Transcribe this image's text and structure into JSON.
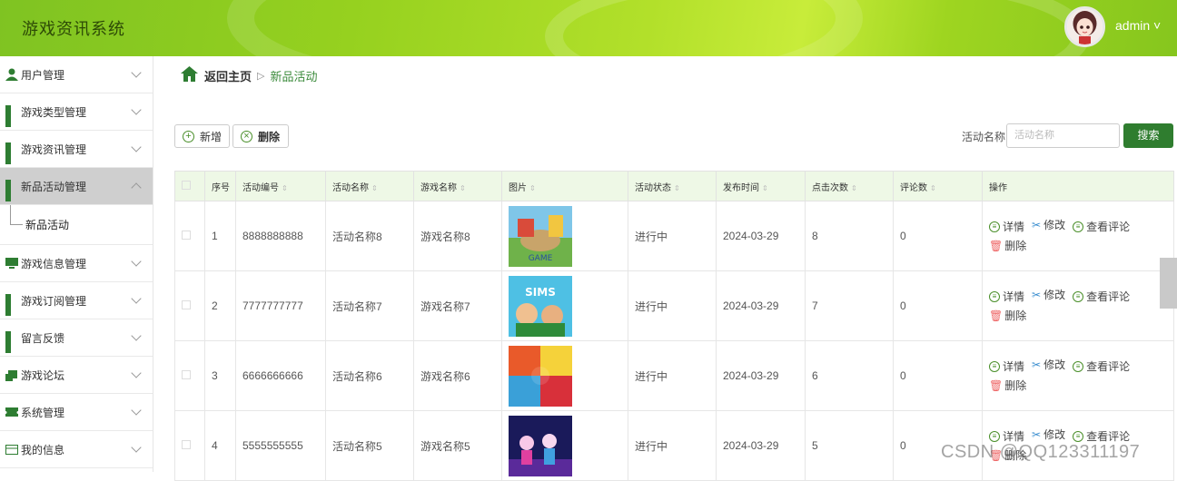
{
  "header": {
    "app_title": "游戏资讯系统",
    "user": "admin ˅"
  },
  "sidebar": {
    "items": [
      {
        "label": "用户管理",
        "icon": "user-icon",
        "active": false,
        "expanded": false
      },
      {
        "label": "游戏类型管理",
        "icon": "grid-icon",
        "active": false,
        "expanded": false
      },
      {
        "label": "游戏资讯管理",
        "icon": "grid-icon",
        "active": false,
        "expanded": false
      },
      {
        "label": "新品活动管理",
        "icon": "grid-icon",
        "active": true,
        "expanded": true
      },
      {
        "label": "游戏信息管理",
        "icon": "monitor-icon",
        "active": false,
        "expanded": false
      },
      {
        "label": "游戏订阅管理",
        "icon": "grid-icon",
        "active": false,
        "expanded": false
      },
      {
        "label": "留言反馈",
        "icon": "grid-icon",
        "active": false,
        "expanded": false
      },
      {
        "label": "游戏论坛",
        "icon": "forum-icon",
        "active": false,
        "expanded": false
      },
      {
        "label": "系统管理",
        "icon": "ticket-icon",
        "active": false,
        "expanded": false
      },
      {
        "label": "我的信息",
        "icon": "card-icon",
        "active": false,
        "expanded": false
      }
    ],
    "sub_item": "新品活动"
  },
  "breadcrumb": {
    "home": "返回主页",
    "separator": "▷",
    "current": "新品活动"
  },
  "toolbar": {
    "add_label": "新增",
    "delete_label": "删除"
  },
  "search": {
    "label": "活动名称",
    "placeholder": "活动名称",
    "button": "搜索"
  },
  "table": {
    "headers": [
      "序号",
      "活动编号",
      "活动名称",
      "游戏名称",
      "图片",
      "活动状态",
      "发布时间",
      "点击次数",
      "评论数",
      "操作"
    ],
    "rows": [
      {
        "index": "1",
        "code": "8888888888",
        "name": "活动名称8",
        "game": "游戏名称8",
        "status": "进行中",
        "date": "2024-03-29",
        "clicks": "8",
        "comments": "0"
      },
      {
        "index": "2",
        "code": "7777777777",
        "name": "活动名称7",
        "game": "游戏名称7",
        "status": "进行中",
        "date": "2024-03-29",
        "clicks": "7",
        "comments": "0"
      },
      {
        "index": "3",
        "code": "6666666666",
        "name": "活动名称6",
        "game": "游戏名称6",
        "status": "进行中",
        "date": "2024-03-29",
        "clicks": "6",
        "comments": "0"
      },
      {
        "index": "4",
        "code": "5555555555",
        "name": "活动名称5",
        "game": "游戏名称5",
        "status": "进行中",
        "date": "2024-03-29",
        "clicks": "5",
        "comments": "0"
      }
    ],
    "actions": {
      "detail": "详情",
      "edit": "修改",
      "comments": "查看评论",
      "delete": "删除"
    }
  },
  "watermark": "CSDN @QQ123311197",
  "colors": {
    "header": "#8ccb1f",
    "primary": "#2f7d2f",
    "table_header": "#eef8e6"
  }
}
